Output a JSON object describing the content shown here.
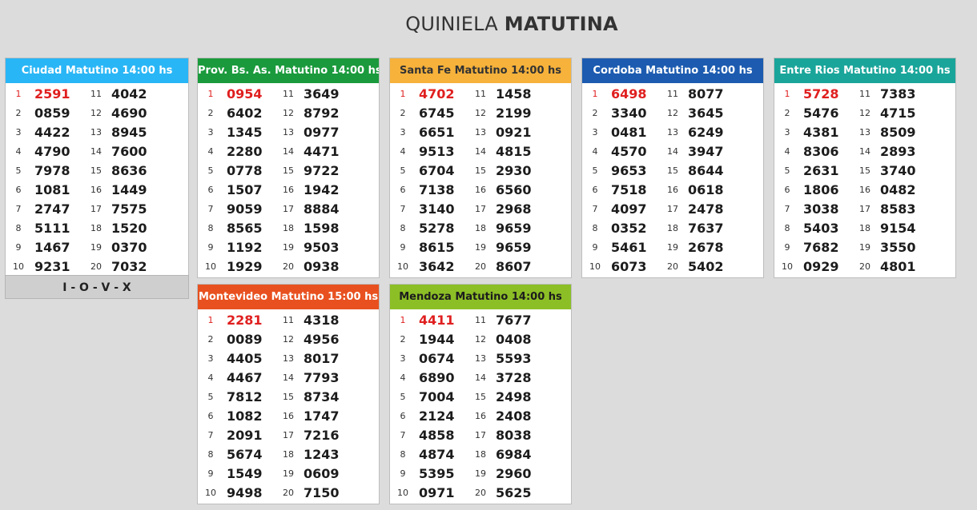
{
  "title": {
    "normal": "QUINIELA",
    "bold": "MATUTINA"
  },
  "footer_label": "I - O - V - X",
  "cards": [
    {
      "title": "Ciudad Matutino 14:00 hs",
      "color": "#29b6f6",
      "numbers": [
        "2591",
        "0859",
        "4422",
        "4790",
        "7978",
        "1081",
        "2747",
        "5111",
        "1467",
        "9231",
        "4042",
        "4690",
        "8945",
        "7600",
        "8636",
        "1449",
        "7575",
        "1520",
        "0370",
        "7032"
      ]
    },
    {
      "title": "Prov. Bs. As. Matutino 14:00 hs",
      "color": "#1a9a3c",
      "numbers": [
        "0954",
        "6402",
        "1345",
        "2280",
        "0778",
        "1507",
        "9059",
        "8565",
        "1192",
        "1929",
        "3649",
        "8792",
        "0977",
        "4471",
        "9722",
        "1942",
        "8884",
        "1598",
        "9503",
        "0938"
      ]
    },
    {
      "title": "Santa Fe Matutino 14:00 hs",
      "color": "#f7b23b",
      "text_color": "#333333",
      "numbers": [
        "4702",
        "6745",
        "6651",
        "9513",
        "6704",
        "7138",
        "3140",
        "5278",
        "8615",
        "3642",
        "1458",
        "2199",
        "0921",
        "4815",
        "2930",
        "6560",
        "2968",
        "9659",
        "9659",
        "8607"
      ]
    },
    {
      "title": "Cordoba Matutino 14:00 hs",
      "color": "#1c5bb0",
      "numbers": [
        "6498",
        "3340",
        "0481",
        "4570",
        "9653",
        "7518",
        "4097",
        "0352",
        "5461",
        "6073",
        "8077",
        "3645",
        "6249",
        "3947",
        "8644",
        "0618",
        "2478",
        "7637",
        "2678",
        "5402"
      ]
    },
    {
      "title": "Entre Rios Matutino 14:00 hs",
      "color": "#1aa59a",
      "numbers": [
        "5728",
        "5476",
        "4381",
        "8306",
        "2631",
        "1806",
        "3038",
        "5403",
        "7682",
        "0929",
        "7383",
        "4715",
        "8509",
        "2893",
        "3740",
        "0482",
        "8583",
        "9154",
        "3550",
        "4801"
      ]
    },
    {
      "title": "Montevideo Matutino 15:00 hs",
      "color": "#e8511f",
      "numbers": [
        "2281",
        "0089",
        "4405",
        "4467",
        "7812",
        "1082",
        "2091",
        "5674",
        "1549",
        "9498",
        "4318",
        "4956",
        "8017",
        "7793",
        "8734",
        "1747",
        "7216",
        "1243",
        "0609",
        "7150"
      ]
    },
    {
      "title": "Mendoza Matutino 14:00 hs",
      "color": "#8cbf26",
      "text_color": "#1c1c1c",
      "numbers": [
        "4411",
        "1944",
        "0674",
        "6890",
        "7004",
        "2124",
        "4858",
        "4874",
        "5395",
        "0971",
        "7677",
        "0408",
        "5593",
        "3728",
        "2498",
        "2408",
        "8038",
        "6984",
        "2960",
        "5625"
      ]
    }
  ]
}
